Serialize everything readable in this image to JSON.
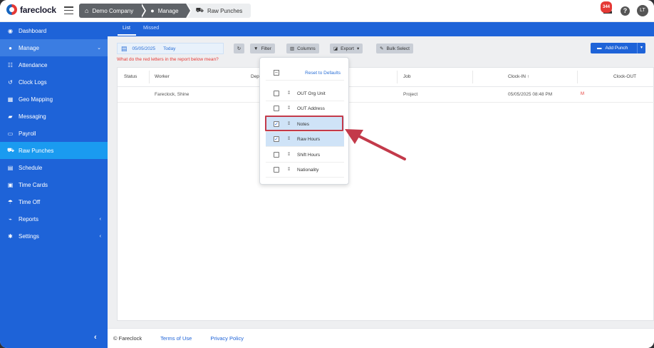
{
  "app": {
    "logo_text": "fareclock"
  },
  "breadcrumb": {
    "company": "Demo Company",
    "section": "Manage",
    "page": "Raw Punches"
  },
  "topbar": {
    "notification_count": "344",
    "avatar_initials": "LT"
  },
  "sidebar": {
    "items": [
      {
        "label": "Dashboard",
        "icon": "dashboard-icon"
      },
      {
        "label": "Manage",
        "icon": "user-icon"
      },
      {
        "label": "Attendance",
        "icon": "attendance-icon"
      },
      {
        "label": "Clock Logs",
        "icon": "history-icon"
      },
      {
        "label": "Geo Mapping",
        "icon": "map-icon"
      },
      {
        "label": "Messaging",
        "icon": "message-icon"
      },
      {
        "label": "Payroll",
        "icon": "payroll-icon"
      },
      {
        "label": "Raw Punches",
        "icon": "punch-icon"
      },
      {
        "label": "Schedule",
        "icon": "calendar-icon"
      },
      {
        "label": "Time Cards",
        "icon": "timecard-icon"
      },
      {
        "label": "Time Off",
        "icon": "beach-icon"
      },
      {
        "label": "Reports",
        "icon": "chart-icon"
      },
      {
        "label": "Settings",
        "icon": "gear-icon"
      }
    ]
  },
  "tabs": {
    "list": "List",
    "missed": "Missed"
  },
  "toolbar": {
    "date": "05/05/2025",
    "today": "Today",
    "red_note": "What do the red letters in the report below mean?",
    "filter": "Filter",
    "columns": "Columns",
    "export": "Export",
    "bulk_select": "Bulk Select",
    "add_punch": "Add Punch"
  },
  "table": {
    "headers": {
      "status": "Status",
      "worker": "Worker",
      "dept": "Depa",
      "job": "Job",
      "clock_in": "Clock-IN",
      "clock_out": "Clock-OUT"
    },
    "rows": [
      {
        "worker": "Fareclock, Shine",
        "job": "Project",
        "clock_in": "05/05/2025 08:48 PM",
        "flag": "M"
      }
    ]
  },
  "columns_menu": {
    "reset": "Reset to Defaults",
    "items": [
      {
        "label": "OUT Org Unit",
        "checked": false
      },
      {
        "label": "OUT Address",
        "checked": false
      },
      {
        "label": "Notes",
        "checked": true
      },
      {
        "label": "Raw Hours",
        "checked": true
      },
      {
        "label": "Shift Hours",
        "checked": false
      },
      {
        "label": "Nationality",
        "checked": false
      }
    ]
  },
  "footer": {
    "copyright": "© Fareclock",
    "terms": "Terms of Use",
    "privacy": "Privacy Policy"
  },
  "colors": {
    "sidebar": "#1e63d8",
    "active": "#1a9bf0",
    "annotation": "#c33a4a"
  }
}
